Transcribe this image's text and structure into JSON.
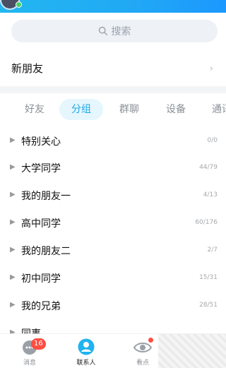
{
  "search": {
    "placeholder_text": "搜索"
  },
  "new_friend": {
    "label": "新朋友",
    "chevron": "›"
  },
  "tabs": [
    {
      "label": "好友",
      "active": false
    },
    {
      "label": "分组",
      "active": true
    },
    {
      "label": "群聊",
      "active": false
    },
    {
      "label": "设备",
      "active": false
    },
    {
      "label": "通讯",
      "active": false
    }
  ],
  "groups": [
    {
      "name": "特别关心",
      "count": "0/0"
    },
    {
      "name": "大学同学",
      "count": "44/79"
    },
    {
      "name": "我的朋友一",
      "count": "4/13"
    },
    {
      "name": "高中同学",
      "count": "60/176"
    },
    {
      "name": "我的朋友二",
      "count": "2/7"
    },
    {
      "name": "初中同学",
      "count": "15/31"
    },
    {
      "name": "我的兄弟",
      "count": "28/51"
    },
    {
      "name": "同事",
      "count": ""
    }
  ],
  "bottom_nav": {
    "messages_label": "消息",
    "messages_badge": "16",
    "contacts_label": "联系人",
    "look_label": "看点"
  },
  "colors": {
    "header_blue": "#21a8f5",
    "active_tab_bg": "#e6f6fd",
    "active_tab_text": "#1aa8e8",
    "badge_red": "#ff4d40"
  },
  "icons": {
    "search": "search-icon",
    "caret": "caret-right-icon",
    "chevron": "chevron-right-icon",
    "messages": "chat-bubble-icon",
    "contacts": "person-icon",
    "look": "eye-icon"
  }
}
